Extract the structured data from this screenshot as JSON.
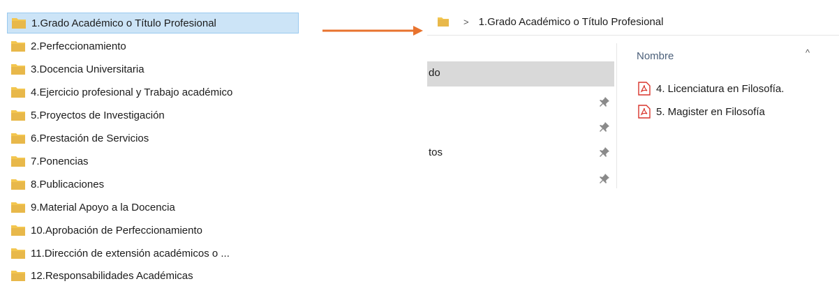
{
  "left_list": {
    "folders": [
      {
        "label": "1.Grado Académico o Título Profesional",
        "selected": true
      },
      {
        "label": "2.Perfeccionamiento"
      },
      {
        "label": "3.Docencia Universitaria"
      },
      {
        "label": "4.Ejercicio profesional y Trabajo académico"
      },
      {
        "label": "5.Proyectos de Investigación"
      },
      {
        "label": "6.Prestación de Servicios"
      },
      {
        "label": "7.Ponencias"
      },
      {
        "label": "8.Publicaciones"
      },
      {
        "label": "9.Material Apoyo a la Docencia"
      },
      {
        "label": "10.Aprobación de Perfeccionamiento"
      },
      {
        "label": "11.Dirección de extensión académicos o ..."
      },
      {
        "label": "12.Responsabilidades Académicas"
      }
    ]
  },
  "arrow": {
    "color": "#e8732e"
  },
  "explorer": {
    "breadcrumb_separator": ">",
    "breadcrumb": "1.Grado Académico o Título Profesional",
    "nav": {
      "selected_fragment": "do",
      "cut_fragment": "tos",
      "pin_icon": "pin-icon"
    },
    "column_header": "Nombre",
    "sort_indicator": "^",
    "files": [
      {
        "label": "4. Licenciatura en Filosofía.",
        "icon": "pdf-icon"
      },
      {
        "label": "5. Magister en Filosofía",
        "icon": "pdf-icon"
      }
    ]
  },
  "colors": {
    "folder": "#e8b84a",
    "selection_bg": "#cce4f7",
    "selection_border": "#99c9ef",
    "pdf_red": "#d9342b"
  }
}
